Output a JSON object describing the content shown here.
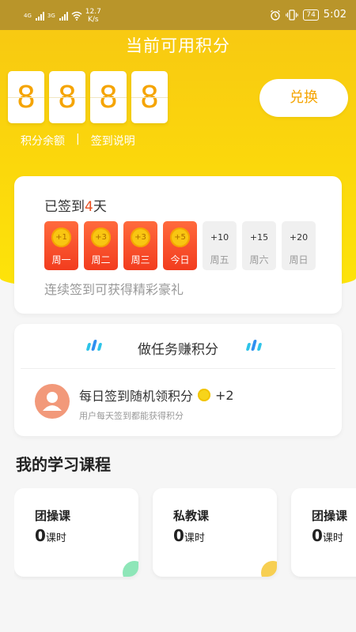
{
  "status_bar": {
    "signal_1": "4G",
    "signal_2": "3G",
    "speed_value": "12.7",
    "speed_unit": "K/s",
    "battery": "74",
    "time": "5:02"
  },
  "points": {
    "title": "当前可用积分",
    "digits": [
      "8",
      "8",
      "8",
      "8"
    ],
    "balance_link": "积分余额",
    "separator": "|",
    "rules_link": "签到说明",
    "exchange_button": "兑换"
  },
  "checkin": {
    "title_prefix": "已签到",
    "days_count": "4",
    "title_suffix": "天",
    "days": [
      {
        "reward": "+1",
        "label": "周一",
        "done": true
      },
      {
        "reward": "+3",
        "label": "周二",
        "done": true
      },
      {
        "reward": "+3",
        "label": "周三",
        "done": true
      },
      {
        "reward": "+5",
        "label": "今日",
        "done": true
      },
      {
        "reward": "+10",
        "label": "周五",
        "done": false
      },
      {
        "reward": "+15",
        "label": "周六",
        "done": false
      },
      {
        "reward": "+20",
        "label": "周日",
        "done": false
      }
    ],
    "note": "连续签到可获得精彩豪礼"
  },
  "tasks": {
    "header": "做任务赚积分",
    "items": [
      {
        "title": "每日签到随机领积分",
        "reward": "+2",
        "subtitle": "用户每天签到都能获得积分",
        "icon": "user-avatar-icon"
      }
    ]
  },
  "courses": {
    "title": "我的学习课程",
    "items": [
      {
        "name": "团操课",
        "count": "0",
        "unit": "课时",
        "accent": "#8ee6b8"
      },
      {
        "name": "私教课",
        "count": "0",
        "unit": "课时",
        "accent": "#f7cf52"
      },
      {
        "name": "团操课",
        "count": "0",
        "unit": "课时",
        "accent": "#f7cf52"
      }
    ]
  },
  "colors": {
    "brand_yellow": "#fbd70c",
    "accent_orange": "#f5a400",
    "checkin_red": "#f23c1e"
  }
}
